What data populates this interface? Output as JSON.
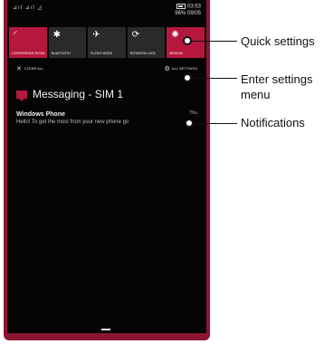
{
  "status_bar": {
    "signal": "⊿ıl ⊿ıl ◿",
    "time": "03:53",
    "battery": "96%",
    "date": "09/05"
  },
  "quick_settings": [
    {
      "label": "CONFERENCE ROOM",
      "icon": "wifi-icon",
      "glyph": "◜",
      "active": true
    },
    {
      "label": "BLUETOOTH",
      "icon": "bluetooth-icon",
      "glyph": "✱",
      "active": false
    },
    {
      "label": "FLIGHT MODE",
      "icon": "airplane-icon",
      "glyph": "✈",
      "active": false
    },
    {
      "label": "ROTATION LOCK",
      "icon": "rotation-lock-icon",
      "glyph": "⟳",
      "active": false
    },
    {
      "label": "MEDIUM",
      "icon": "brightness-icon",
      "glyph": "✺",
      "active": true
    }
  ],
  "actions": {
    "clear_all": "CLEAR ALL",
    "all_settings": "ALL SETTINGS"
  },
  "notification_group": {
    "app": "Messaging - SIM 1",
    "items": [
      {
        "title": "Windows Phone",
        "body": "Hello! To get the most from your new phone go",
        "time": "Thu"
      }
    ]
  },
  "callouts": {
    "quick_settings": "Quick settings",
    "enter_settings": "Enter settings menu",
    "notifications": "Notifications"
  },
  "colors": {
    "accent": "#b5173d",
    "device_frame": "#8c1630",
    "screen_bg": "#050505"
  }
}
